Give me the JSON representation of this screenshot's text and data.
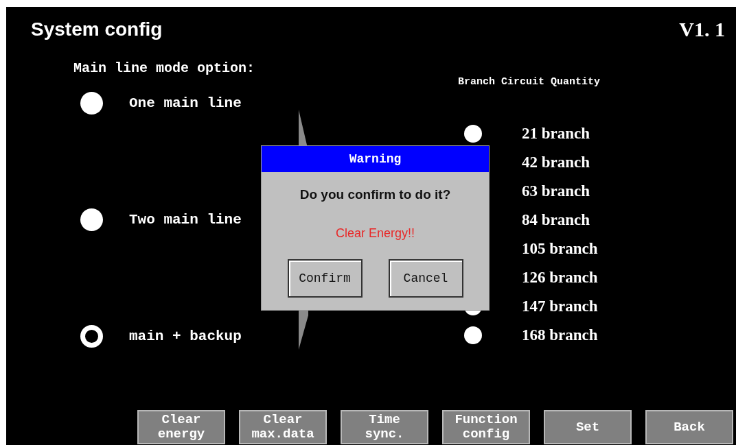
{
  "screen": {
    "title": "System config",
    "version": "V1. 1"
  },
  "main_line_mode": {
    "label": "Main line mode option:",
    "options": [
      {
        "label": "One main line",
        "selected": false
      },
      {
        "label": "Two main line",
        "selected": false
      },
      {
        "label": "main + backup",
        "selected": true
      }
    ]
  },
  "branch_quantity": {
    "label": "Branch Circuit Quantity",
    "options": [
      {
        "label": "21 branch",
        "selected": false
      },
      {
        "label": "42 branch"
      },
      {
        "label": "63 branch"
      },
      {
        "label": "84 branch"
      },
      {
        "label": "105 branch"
      },
      {
        "label": "126 branch"
      },
      {
        "label": "147 branch",
        "selected": false
      },
      {
        "label": "168 branch",
        "selected": false
      }
    ]
  },
  "dialog": {
    "title": "Warning",
    "question": "Do you confirm to do it?",
    "action": "Clear Energy!!",
    "buttons": [
      "Confirm",
      "Cancel"
    ]
  },
  "toolbar": [
    "Clear\nenergy",
    "Clear\nmax.data",
    "Time\nsync.",
    "Function\nconfig",
    "Set",
    "Back"
  ]
}
